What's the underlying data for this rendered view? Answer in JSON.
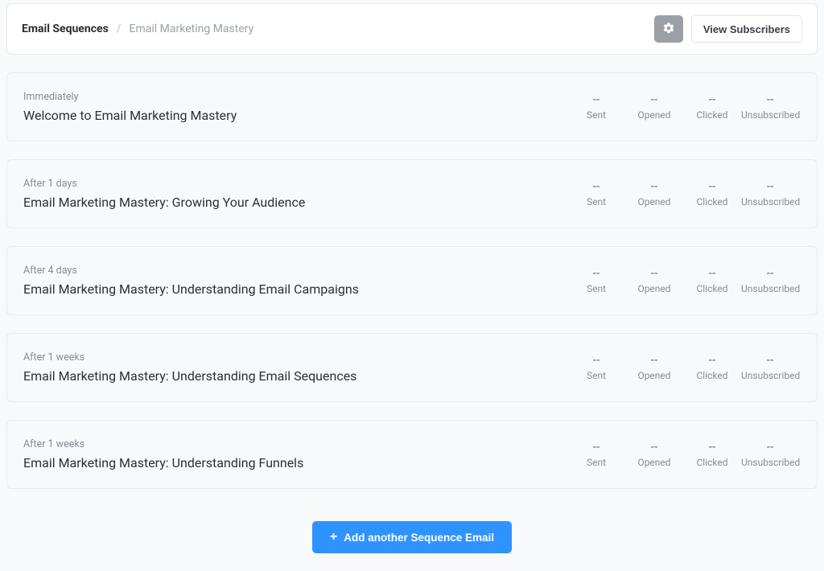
{
  "breadcrumb": {
    "root": "Email Sequences",
    "sep": "/",
    "current": "Email Marketing Mastery"
  },
  "header": {
    "viewSubscribers": "View Subscribers"
  },
  "statLabels": {
    "sent": "Sent",
    "opened": "Opened",
    "clicked": "Clicked",
    "unsubscribed": "Unsubscribed"
  },
  "emails": [
    {
      "timing": "Immediately",
      "title": "Welcome to Email Marketing Mastery",
      "sent": "--",
      "opened": "--",
      "clicked": "--",
      "unsubscribed": "--"
    },
    {
      "timing": "After 1 days",
      "title": "Email Marketing Mastery: Growing Your Audience",
      "sent": "--",
      "opened": "--",
      "clicked": "--",
      "unsubscribed": "--"
    },
    {
      "timing": "After 4 days",
      "title": "Email Marketing Mastery: Understanding Email Campaigns",
      "sent": "--",
      "opened": "--",
      "clicked": "--",
      "unsubscribed": "--"
    },
    {
      "timing": "After 1 weeks",
      "title": "Email Marketing Mastery: Understanding Email Sequences",
      "sent": "--",
      "opened": "--",
      "clicked": "--",
      "unsubscribed": "--"
    },
    {
      "timing": "After 1 weeks",
      "title": "Email Marketing Mastery: Understanding Funnels",
      "sent": "--",
      "opened": "--",
      "clicked": "--",
      "unsubscribed": "--"
    }
  ],
  "actions": {
    "addEmail": "Add another Sequence Email"
  }
}
